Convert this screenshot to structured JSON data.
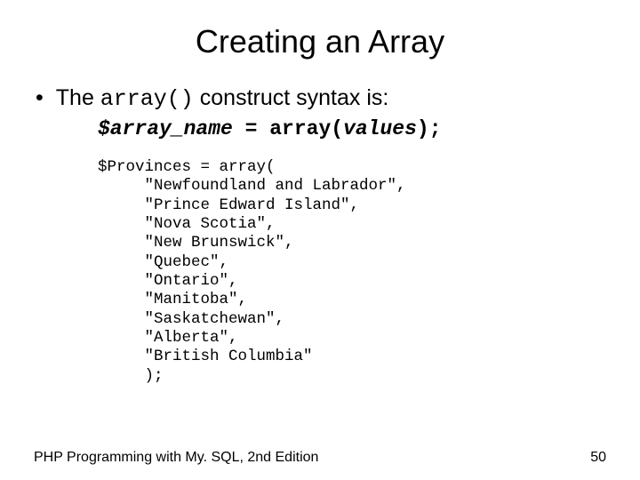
{
  "title": "Creating an Array",
  "bullet": {
    "pre": "The ",
    "code": "array()",
    "post": " construct syntax is:"
  },
  "syntax": {
    "var": "$array_name",
    "eq": " = array(",
    "vals": "values",
    "end": ");"
  },
  "code_lines": [
    "$Provinces = array(",
    "     \"Newfoundland and Labrador\",",
    "     \"Prince Edward Island\",",
    "     \"Nova Scotia\",",
    "     \"New Brunswick\",",
    "     \"Quebec\",",
    "     \"Ontario\",",
    "     \"Manitoba\",",
    "     \"Saskatchewan\",",
    "     \"Alberta\",",
    "     \"British Columbia\"",
    "     );"
  ],
  "footer": {
    "left": "PHP Programming with My. SQL, 2nd Edition",
    "right": "50"
  }
}
